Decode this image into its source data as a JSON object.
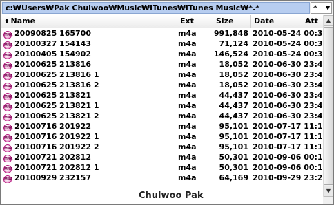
{
  "path_bar": {
    "path": "c:₩Users₩Pak Chulwoo₩Music₩iTunes₩iTunes Music₩*.*",
    "filter_glyph": "*",
    "filter_dropdown_icon": "chevron-down-icon"
  },
  "columns": {
    "name": "Name",
    "ext": "Ext",
    "size": "Size",
    "date": "Date",
    "attr": "Att",
    "sort_icon": "sort-up-arrow-icon"
  },
  "file_icon_text": "M4A",
  "rows": [
    {
      "name": "20090825 165700",
      "ext": "m4a",
      "size": "991,848",
      "date": "2010-05-24 00:30"
    },
    {
      "name": "20100327 154143",
      "ext": "m4a",
      "size": "71,124",
      "date": "2010-05-24 00:30"
    },
    {
      "name": "20100405 154902",
      "ext": "m4a",
      "size": "146,524",
      "date": "2010-05-24 00:30"
    },
    {
      "name": "20100625 213816",
      "ext": "m4a",
      "size": "18,052",
      "date": "2010-06-30 23:47"
    },
    {
      "name": "20100625 213816 1",
      "ext": "m4a",
      "size": "18,052",
      "date": "2010-06-30 23:47"
    },
    {
      "name": "20100625 213816 2",
      "ext": "m4a",
      "size": "18,052",
      "date": "2010-06-30 23:47"
    },
    {
      "name": "20100625 213821",
      "ext": "m4a",
      "size": "44,437",
      "date": "2010-06-30 23:47"
    },
    {
      "name": "20100625 213821 1",
      "ext": "m4a",
      "size": "44,437",
      "date": "2010-06-30 23:47"
    },
    {
      "name": "20100625 213821 2",
      "ext": "m4a",
      "size": "44,437",
      "date": "2010-06-30 23:47"
    },
    {
      "name": "20100716 201922",
      "ext": "m4a",
      "size": "95,101",
      "date": "2010-07-17 11:16"
    },
    {
      "name": "20100716 201922 1",
      "ext": "m4a",
      "size": "95,101",
      "date": "2010-07-17 11:16"
    },
    {
      "name": "20100716 201922 2",
      "ext": "m4a",
      "size": "95,101",
      "date": "2010-07-17 11:16"
    },
    {
      "name": "20100721 202812",
      "ext": "m4a",
      "size": "50,301",
      "date": "2010-09-06 00:15"
    },
    {
      "name": "20100721 202812 1",
      "ext": "m4a",
      "size": "50,301",
      "date": "2010-09-06 00:15"
    },
    {
      "name": "20100929 232157",
      "ext": "m4a",
      "size": "64,169",
      "date": "2010-09-29 23:24"
    }
  ],
  "watermark": "Chulwoo Pak",
  "colors": {
    "path_bar_bg": "#b7cdf0",
    "file_icon": "#d75fae"
  }
}
